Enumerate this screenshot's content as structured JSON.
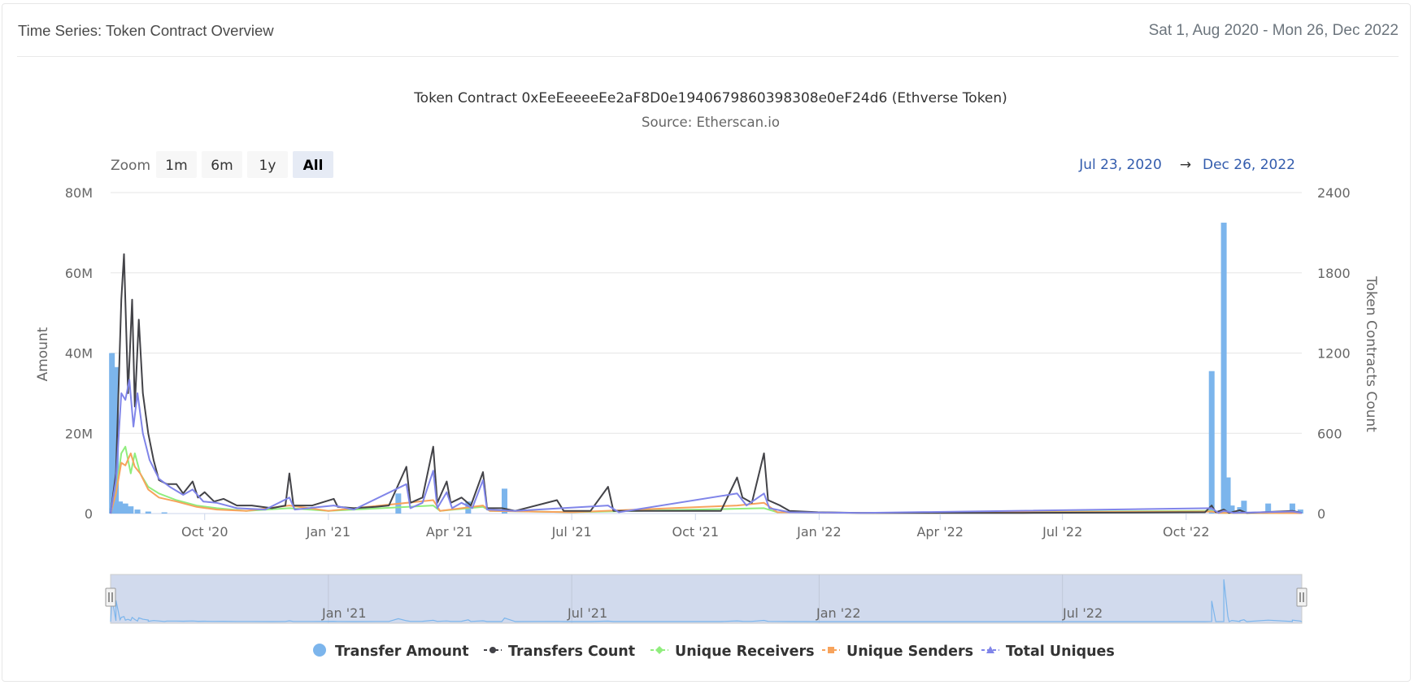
{
  "card": {
    "title": "Time Series: Token Contract Overview",
    "date_range": "Sat 1, Aug 2020 - Mon 26, Dec 2022"
  },
  "range_selector": {
    "zoom_label": "Zoom",
    "buttons": [
      "1m",
      "6m",
      "1y",
      "All"
    ],
    "selected": "All",
    "from": "Jul 23, 2020",
    "arrow": "→",
    "to": "Dec 26, 2022"
  },
  "navigator": {
    "labels": [
      "Jan '21",
      "Jul '21",
      "Jan '22",
      "Jul '22"
    ]
  },
  "colors": {
    "transfer_amount": "#7cb5ec",
    "transfers_count": "#434348",
    "unique_receivers": "#90ed7d",
    "unique_senders": "#f7a35c",
    "total_uniques": "#8085e9",
    "selected_button": "#e6ebf5",
    "navigator_mask": "rgba(102,133,194,0.3)"
  },
  "chart_data": {
    "type": "bar+line",
    "title": "Token Contract 0xEeEeeeeEe2aF8D0e1940679860398308e0eF24d6 (Ethverse Token)",
    "subtitle": "Source: Etherscan.io",
    "x_range": [
      "2020-07-23",
      "2022-12-26"
    ],
    "x_ticks": [
      "Oct '20",
      "Jan '21",
      "Apr '21",
      "Jul '21",
      "Oct '21",
      "Jan '22",
      "Apr '22",
      "Jul '22",
      "Oct '22"
    ],
    "y_left": {
      "label": "Amount",
      "ticks": [
        "0",
        "20M",
        "40M",
        "60M",
        "80M"
      ],
      "range": [
        0,
        80000000
      ]
    },
    "y_right": {
      "label": "Token Contracts Count",
      "ticks": [
        "0",
        "600",
        "1200",
        "1800",
        "2400"
      ],
      "range": [
        0,
        2400
      ]
    },
    "legend": [
      "Transfer Amount",
      "Transfers Count",
      "Unique Receivers",
      "Unique Senders",
      "Total Uniques"
    ],
    "legend_position": "bottom",
    "grid": true,
    "series": [
      {
        "name": "Transfer Amount",
        "axis": "left",
        "kind": "column",
        "points": [
          [
            "2020-07-24",
            40000000
          ],
          [
            "2020-07-27",
            36500000
          ],
          [
            "2020-07-30",
            3000000
          ],
          [
            "2020-08-03",
            2500000
          ],
          [
            "2020-08-07",
            1800000
          ],
          [
            "2020-08-12",
            1000000
          ],
          [
            "2020-08-20",
            500000
          ],
          [
            "2020-09-01",
            300000
          ],
          [
            "2021-02-22",
            5000000
          ],
          [
            "2021-04-15",
            3000000
          ],
          [
            "2021-05-12",
            6200000
          ],
          [
            "2022-10-20",
            35500000
          ],
          [
            "2022-10-29",
            72500000
          ],
          [
            "2022-11-01",
            9000000
          ],
          [
            "2022-11-04",
            2000000
          ],
          [
            "2022-11-10",
            1600000
          ],
          [
            "2022-11-13",
            3200000
          ],
          [
            "2022-12-01",
            2500000
          ],
          [
            "2022-12-19",
            2500000
          ],
          [
            "2022-12-25",
            1000000
          ]
        ]
      },
      {
        "name": "Transfers Count",
        "axis": "right",
        "kind": "line",
        "points": [
          [
            "2020-07-23",
            0
          ],
          [
            "2020-07-27",
            300
          ],
          [
            "2020-07-31",
            1600
          ],
          [
            "2020-08-02",
            1940
          ],
          [
            "2020-08-05",
            900
          ],
          [
            "2020-08-08",
            1600
          ],
          [
            "2020-08-10",
            800
          ],
          [
            "2020-08-13",
            1450
          ],
          [
            "2020-08-16",
            900
          ],
          [
            "2020-08-20",
            600
          ],
          [
            "2020-08-24",
            400
          ],
          [
            "2020-08-28",
            250
          ],
          [
            "2020-09-03",
            220
          ],
          [
            "2020-09-10",
            220
          ],
          [
            "2020-09-15",
            150
          ],
          [
            "2020-09-22",
            240
          ],
          [
            "2020-09-26",
            120
          ],
          [
            "2020-10-01",
            160
          ],
          [
            "2020-10-08",
            90
          ],
          [
            "2020-10-15",
            110
          ],
          [
            "2020-10-25",
            60
          ],
          [
            "2020-11-05",
            60
          ],
          [
            "2020-11-20",
            40
          ],
          [
            "2020-11-30",
            60
          ],
          [
            "2020-12-03",
            300
          ],
          [
            "2020-12-06",
            60
          ],
          [
            "2020-12-20",
            60
          ],
          [
            "2021-01-05",
            110
          ],
          [
            "2021-01-08",
            50
          ],
          [
            "2021-01-20",
            40
          ],
          [
            "2021-02-05",
            50
          ],
          [
            "2021-02-15",
            60
          ],
          [
            "2021-02-28",
            350
          ],
          [
            "2021-03-03",
            80
          ],
          [
            "2021-03-12",
            120
          ],
          [
            "2021-03-20",
            500
          ],
          [
            "2021-03-23",
            80
          ],
          [
            "2021-03-30",
            240
          ],
          [
            "2021-04-02",
            80
          ],
          [
            "2021-04-10",
            120
          ],
          [
            "2021-04-17",
            60
          ],
          [
            "2021-04-26",
            310
          ],
          [
            "2021-04-29",
            40
          ],
          [
            "2021-05-10",
            40
          ],
          [
            "2021-05-20",
            20
          ],
          [
            "2021-06-20",
            100
          ],
          [
            "2021-06-25",
            20
          ],
          [
            "2021-07-15",
            20
          ],
          [
            "2021-07-28",
            200
          ],
          [
            "2021-08-01",
            20
          ],
          [
            "2021-09-15",
            20
          ],
          [
            "2021-10-01",
            20
          ],
          [
            "2021-10-20",
            20
          ],
          [
            "2021-11-01",
            270
          ],
          [
            "2021-11-05",
            120
          ],
          [
            "2021-11-12",
            80
          ],
          [
            "2021-11-21",
            450
          ],
          [
            "2021-11-24",
            100
          ],
          [
            "2021-12-03",
            60
          ],
          [
            "2021-12-10",
            20
          ],
          [
            "2021-12-31",
            10
          ],
          [
            "2022-02-01",
            5
          ],
          [
            "2022-06-01",
            5
          ],
          [
            "2022-10-15",
            10
          ],
          [
            "2022-10-20",
            60
          ],
          [
            "2022-10-23",
            10
          ],
          [
            "2022-10-29",
            30
          ],
          [
            "2022-11-02",
            5
          ],
          [
            "2022-11-10",
            25
          ],
          [
            "2022-11-15",
            5
          ],
          [
            "2022-12-19",
            20
          ],
          [
            "2022-12-26",
            5
          ]
        ]
      },
      {
        "name": "Unique Receivers",
        "axis": "right",
        "kind": "line",
        "points": [
          [
            "2020-07-23",
            0
          ],
          [
            "2020-07-27",
            150
          ],
          [
            "2020-07-31",
            450
          ],
          [
            "2020-08-03",
            500
          ],
          [
            "2020-08-07",
            300
          ],
          [
            "2020-08-10",
            450
          ],
          [
            "2020-08-14",
            300
          ],
          [
            "2020-08-20",
            200
          ],
          [
            "2020-08-28",
            150
          ],
          [
            "2020-09-10",
            100
          ],
          [
            "2020-09-25",
            60
          ],
          [
            "2020-10-10",
            40
          ],
          [
            "2020-11-01",
            20
          ],
          [
            "2020-12-03",
            40
          ],
          [
            "2021-01-01",
            20
          ],
          [
            "2021-03-20",
            60
          ],
          [
            "2021-03-25",
            20
          ],
          [
            "2021-04-26",
            50
          ],
          [
            "2021-05-01",
            20
          ],
          [
            "2021-07-01",
            10
          ],
          [
            "2021-11-21",
            40
          ],
          [
            "2021-12-01",
            10
          ],
          [
            "2022-02-01",
            5
          ],
          [
            "2022-10-20",
            20
          ],
          [
            "2022-10-25",
            5
          ],
          [
            "2022-12-26",
            3
          ]
        ]
      },
      {
        "name": "Unique Senders",
        "axis": "right",
        "kind": "line",
        "points": [
          [
            "2020-07-23",
            0
          ],
          [
            "2020-07-27",
            150
          ],
          [
            "2020-07-31",
            380
          ],
          [
            "2020-08-03",
            360
          ],
          [
            "2020-08-07",
            450
          ],
          [
            "2020-08-10",
            350
          ],
          [
            "2020-08-14",
            300
          ],
          [
            "2020-08-20",
            180
          ],
          [
            "2020-08-28",
            120
          ],
          [
            "2020-09-10",
            90
          ],
          [
            "2020-09-25",
            50
          ],
          [
            "2020-10-10",
            30
          ],
          [
            "2020-11-01",
            20
          ],
          [
            "2020-12-03",
            60
          ],
          [
            "2021-01-01",
            20
          ],
          [
            "2021-03-20",
            100
          ],
          [
            "2021-03-25",
            20
          ],
          [
            "2021-04-26",
            60
          ],
          [
            "2021-05-01",
            20
          ],
          [
            "2021-07-01",
            10
          ],
          [
            "2021-11-01",
            60
          ],
          [
            "2021-11-21",
            80
          ],
          [
            "2021-12-01",
            10
          ],
          [
            "2022-02-01",
            5
          ],
          [
            "2022-10-20",
            15
          ],
          [
            "2022-10-25",
            5
          ],
          [
            "2022-12-26",
            3
          ]
        ]
      },
      {
        "name": "Total Uniques",
        "axis": "right",
        "kind": "line",
        "points": [
          [
            "2020-07-23",
            0
          ],
          [
            "2020-07-27",
            250
          ],
          [
            "2020-07-31",
            900
          ],
          [
            "2020-08-03",
            850
          ],
          [
            "2020-08-06",
            1000
          ],
          [
            "2020-08-09",
            650
          ],
          [
            "2020-08-12",
            900
          ],
          [
            "2020-08-16",
            600
          ],
          [
            "2020-08-21",
            400
          ],
          [
            "2020-08-28",
            260
          ],
          [
            "2020-09-05",
            200
          ],
          [
            "2020-09-15",
            140
          ],
          [
            "2020-09-22",
            180
          ],
          [
            "2020-09-30",
            90
          ],
          [
            "2020-10-10",
            80
          ],
          [
            "2020-10-25",
            40
          ],
          [
            "2020-11-15",
            30
          ],
          [
            "2020-12-03",
            120
          ],
          [
            "2020-12-07",
            30
          ],
          [
            "2021-01-05",
            60
          ],
          [
            "2021-01-20",
            30
          ],
          [
            "2021-02-28",
            220
          ],
          [
            "2021-03-03",
            40
          ],
          [
            "2021-03-12",
            80
          ],
          [
            "2021-03-20",
            320
          ],
          [
            "2021-03-23",
            40
          ],
          [
            "2021-03-30",
            160
          ],
          [
            "2021-04-03",
            40
          ],
          [
            "2021-04-10",
            80
          ],
          [
            "2021-04-18",
            40
          ],
          [
            "2021-04-26",
            250
          ],
          [
            "2021-04-29",
            30
          ],
          [
            "2021-05-20",
            20
          ],
          [
            "2021-07-28",
            60
          ],
          [
            "2021-08-05",
            10
          ],
          [
            "2021-11-01",
            150
          ],
          [
            "2021-11-08",
            60
          ],
          [
            "2021-11-21",
            150
          ],
          [
            "2021-11-25",
            40
          ],
          [
            "2021-12-10",
            10
          ],
          [
            "2022-02-01",
            5
          ],
          [
            "2022-10-20",
            40
          ],
          [
            "2022-10-25",
            5
          ],
          [
            "2022-10-29",
            20
          ],
          [
            "2022-11-05",
            5
          ],
          [
            "2022-12-19",
            15
          ],
          [
            "2022-12-26",
            5
          ]
        ]
      }
    ]
  }
}
